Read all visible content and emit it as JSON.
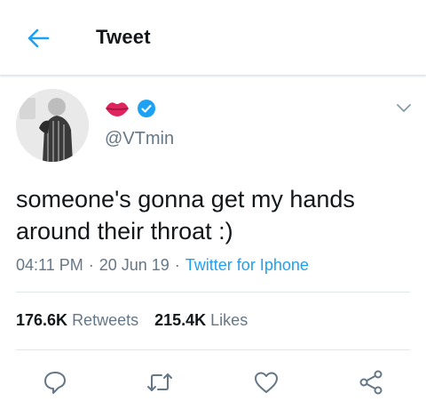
{
  "header": {
    "title": "Tweet",
    "back_icon": "arrow-left-icon"
  },
  "tweet": {
    "badges": [
      "lips-emoji-icon",
      "verified-badge-icon"
    ],
    "handle": "@VTmin",
    "text": "someone's gonna get my hands around their throat :)",
    "time": "04:11 PM",
    "date": "20 Jun 19",
    "separator": "·",
    "source": "Twitter for Iphone"
  },
  "stats": {
    "retweets_count": "176.6K",
    "retweets_label": "Retweets",
    "likes_count": "215.4K",
    "likes_label": "Likes"
  },
  "actions": [
    "reply-icon",
    "retweet-icon",
    "like-icon",
    "share-icon"
  ],
  "colors": {
    "accent": "#1da1f2",
    "text": "#14171a",
    "secondary": "#657786",
    "divider": "#e1e8ed",
    "lips": "#e0245e"
  }
}
